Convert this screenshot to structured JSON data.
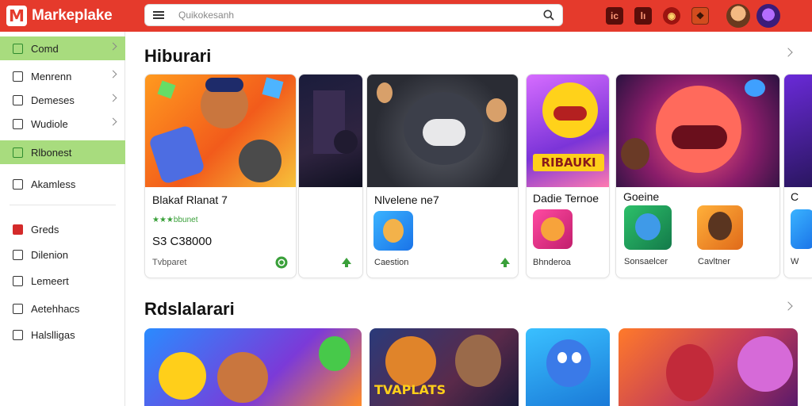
{
  "header": {
    "brand": "Markeplake",
    "brand_logo": "M",
    "search_placeholder": "Quikokesanh",
    "icons": [
      "notification-icon",
      "download-icon",
      "game-icon",
      "gift-icon"
    ],
    "accent": "#e53a2c"
  },
  "sidebar": {
    "items": [
      {
        "label": "Comd",
        "icon": "home-icon",
        "active": true
      },
      {
        "label": "Menrenn",
        "icon": "menu-icon"
      },
      {
        "label": "Demeses",
        "icon": "list-icon"
      },
      {
        "label": "Wudiole",
        "icon": "square-icon"
      },
      {
        "label": "Rlbonest",
        "icon": "tag-icon",
        "active": true
      },
      {
        "label": "Akamless",
        "icon": "bag-icon"
      },
      {
        "label": "Greds",
        "icon": "grid-icon"
      },
      {
        "label": "Dilenion",
        "icon": "folder-icon"
      },
      {
        "label": "Lemeert",
        "icon": "doc-icon"
      },
      {
        "label": "Aetehhacs",
        "icon": "tool-icon"
      },
      {
        "label": "Halslligas",
        "icon": "settings-icon"
      }
    ]
  },
  "sections": [
    {
      "title": "Hiburari"
    },
    {
      "title": "Rdslalarari"
    }
  ],
  "cards": {
    "c1": {
      "title": "Blakaf Rlanat 7",
      "rating": "★★★bbunet",
      "price": "S3 C38000",
      "sub": "Tvbparet"
    },
    "c3": {
      "title": "Nlvelene ne7",
      "app_label": "Caestion"
    },
    "c4": {
      "title": "Dadie Ternoe",
      "app_label": "Bhnderoa",
      "art_text": "RIBAUKI"
    },
    "c5": {
      "title": "Goeine",
      "app1_label": "Sonsaelcer",
      "app2_label": "Cavltner"
    },
    "c6": {
      "title": "C",
      "app_label": "W"
    }
  },
  "banners": [
    {
      "art_text": ""
    },
    {
      "art_text": "TVAPLATS"
    },
    {
      "art_text": ""
    },
    {
      "art_text": ""
    }
  ]
}
